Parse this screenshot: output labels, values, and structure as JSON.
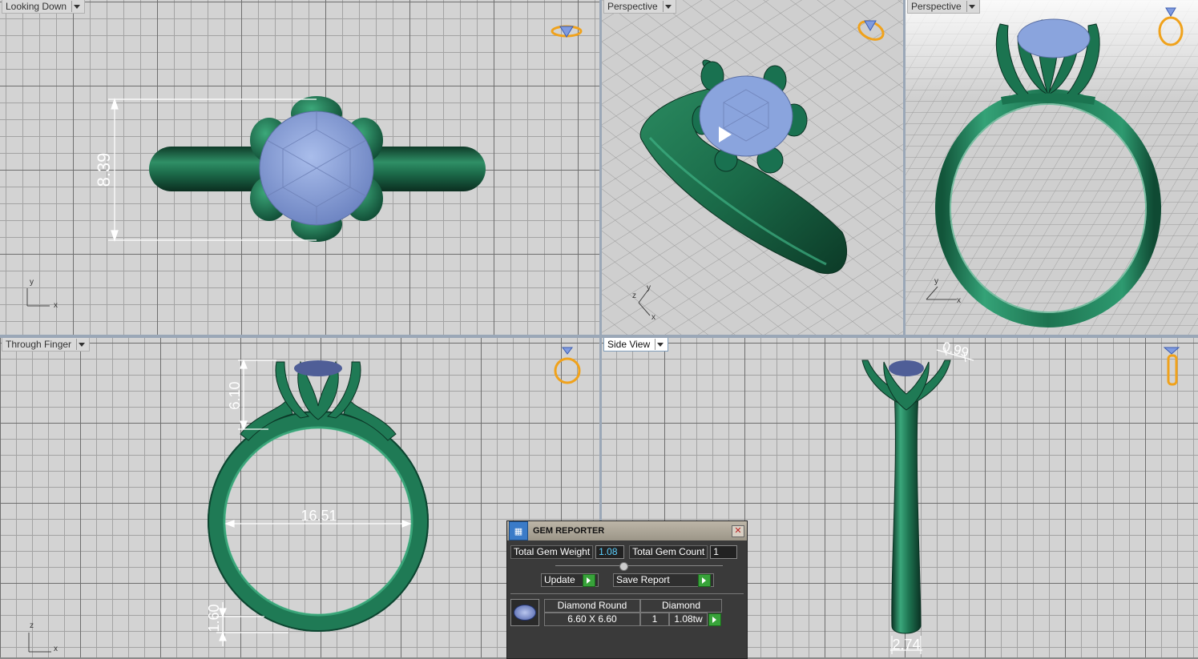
{
  "viewports": {
    "top_left": {
      "label": "Looking Down",
      "axis_x": "x",
      "axis_y": "y",
      "dimension": "8.39"
    },
    "top_middle": {
      "label": "Perspective",
      "axis_x": "x",
      "axis_y": "y",
      "axis_z": "z"
    },
    "top_right": {
      "label": "Perspective",
      "axis_x": "x",
      "axis_y": "y"
    },
    "bottom_left": {
      "label": "Through Finger",
      "axis_x": "x",
      "axis_z": "z",
      "dim_height": "6.10",
      "dim_inner": "16.51",
      "dim_band": "1.60"
    },
    "bottom_right": {
      "label": "Side View",
      "dim_top": "0.99",
      "dim_bottom": "2.74"
    }
  },
  "gem_reporter": {
    "title": "GEM REPORTER",
    "total_gem_weight_label": "Total Gem Weight",
    "total_gem_weight": "1.08",
    "total_gem_count_label": "Total Gem Count",
    "total_gem_count": "1",
    "update_label": "Update",
    "save_report_label": "Save Report",
    "gems": [
      {
        "shape": "Diamond Round",
        "material": "Diamond",
        "size": "6.60 X 6.60",
        "count": "1",
        "weight": "1.08tw"
      }
    ]
  },
  "colors": {
    "metal": "#1f7a55",
    "gem": "#8aa4dd",
    "grid_bg": "#d3d3d3",
    "panel": "#3a3a3a"
  },
  "icons": [
    "view-cube-ring-icon",
    "diamond-icon",
    "play-icon",
    "close-icon",
    "go-arrow-icon",
    "gem-thumbnail-icon"
  ]
}
